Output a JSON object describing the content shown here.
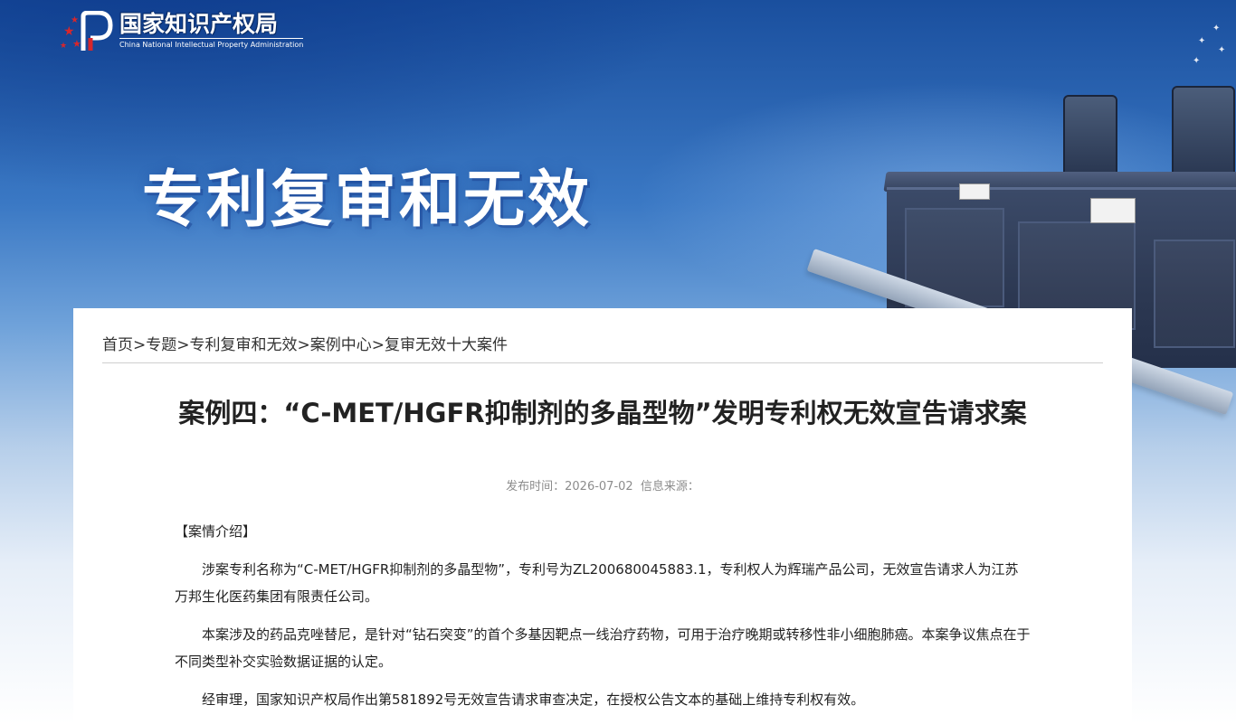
{
  "header": {
    "logo_cn": "国家知识产权局",
    "logo_en": "China National Intellectual Property Administration",
    "hero_title": "专利复审和无效"
  },
  "colors": {
    "banner_dark": "#1a4f9e",
    "logo_red": "#d8262b",
    "text": "#222222",
    "meta": "#8c8c8c"
  },
  "breadcrumb": {
    "items": [
      "首页",
      "专题",
      "专利复审和无效",
      "案例中心",
      "复审无效十大案件"
    ],
    "separator": ">"
  },
  "article": {
    "title": "案例四：“C-MET/HGFR抑制剂的多晶型物”发明专利权无效宣告请求案",
    "publish_label": "发布时间：",
    "publish_date": "2026-07-02",
    "source_label": "信息来源：",
    "section_heading": "【案情介绍】",
    "paragraphs": [
      "涉案专利名称为“C-MET/HGFR抑制剂的多晶型物”，专利号为ZL200680045883.1，专利权人为辉瑞产品公司，无效宣告请求人为江苏万邦生化医药集团有限责任公司。",
      "本案涉及的药品克唑替尼，是针对“钻石突变”的首个多基因靶点一线治疗药物，可用于治疗晚期或转移性非小细胞肺癌。本案争议焦点在于不同类型补交实验数据证据的认定。",
      "经审理，国家知识产权局作出第581892号无效宣告请求审查决定，在授权公告文本的基础上维持专利权有效。"
    ]
  }
}
